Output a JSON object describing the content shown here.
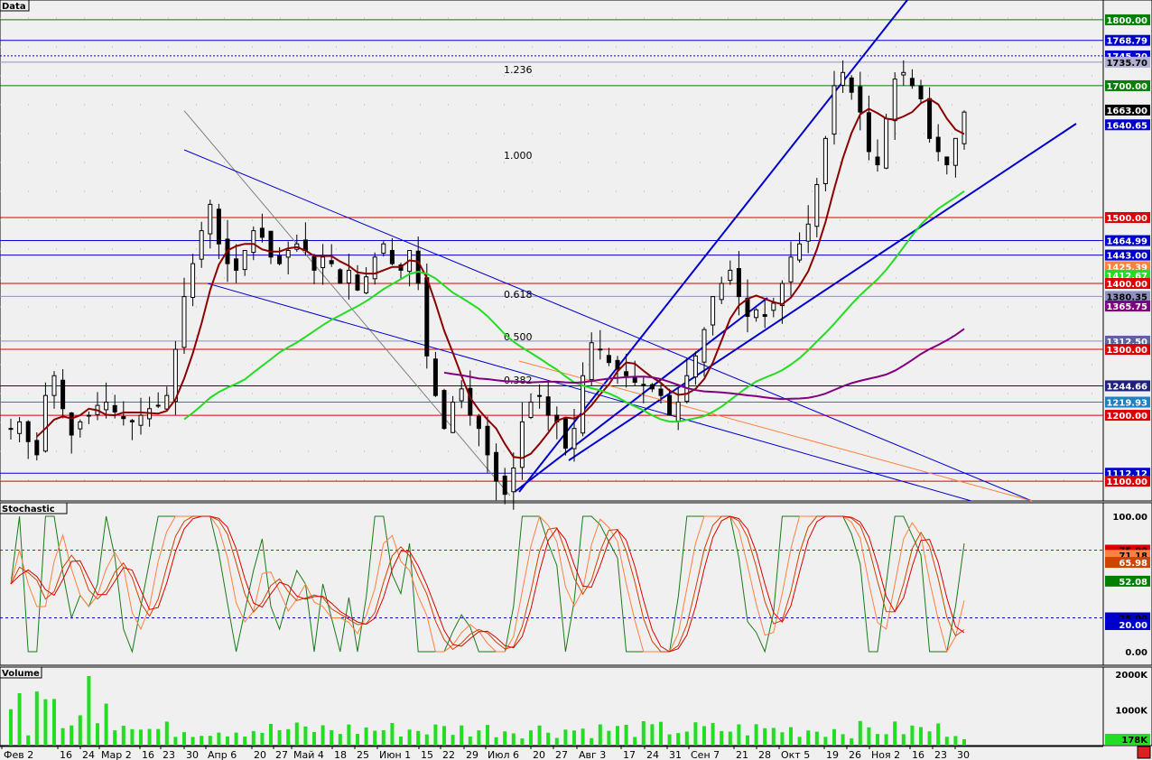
{
  "panels": {
    "price": "Data",
    "stochastic": "Stochastic",
    "volume": "Volume"
  },
  "x_axis": {
    "dates": [
      "Фев 2",
      "16",
      "24",
      "Мар 2",
      "16",
      "23",
      "30",
      "Апр 6",
      "20",
      "27",
      "Май 4",
      "18",
      "25",
      "Июн 1",
      "15",
      "22",
      "29",
      "Июл 6",
      "20",
      "27",
      "Авг 3",
      "17",
      "24",
      "31",
      "Сен 7",
      "21",
      "28",
      "Окт 5",
      "19",
      "26",
      "Ноя 2",
      "16",
      "23",
      "30"
    ]
  },
  "colors": {
    "background": "#f0f0f0",
    "trendline": "#0000cc",
    "ma_fast": "#8b0000",
    "ma_mid": "#22dd22",
    "ma_slow": "#800080",
    "fib_line": "#2020a0",
    "support_red": "#dd0000",
    "level_green": "#008000",
    "stoch_k": "#1a7a1a",
    "stoch_d": "#cc4400",
    "volume": "#22dd22"
  },
  "fib_labels": [
    "1.236",
    "1.000",
    "0.618",
    "0.500",
    "0.382"
  ],
  "price_tags": [
    {
      "text": "1800.00",
      "bg": "#008000",
      "fg": "#ffffff"
    },
    {
      "text": "1768.79",
      "bg": "#0000cc",
      "fg": "#ffffff"
    },
    {
      "text": "1745.20",
      "bg": "#0000cc",
      "fg": "#ffffff"
    },
    {
      "text": "1735.70",
      "bg": "#b0b0d0",
      "fg": "#000000"
    },
    {
      "text": "1700.00",
      "bg": "#008000",
      "fg": "#ffffff"
    },
    {
      "text": "1663.00",
      "bg": "#000000",
      "fg": "#ffffff"
    },
    {
      "text": "1640.65",
      "bg": "#0000cc",
      "fg": "#ffffff"
    },
    {
      "text": "1500.00",
      "bg": "#dd0000",
      "fg": "#ffffff"
    },
    {
      "text": "1464.99",
      "bg": "#0000cc",
      "fg": "#ffffff"
    },
    {
      "text": "1443.00",
      "bg": "#0000cc",
      "fg": "#ffffff"
    },
    {
      "text": "1425.39",
      "bg": "#ff8040",
      "fg": "#ffffff"
    },
    {
      "text": "1412.67",
      "bg": "#22dd22",
      "fg": "#ffffff"
    },
    {
      "text": "1400.00",
      "bg": "#dd0000",
      "fg": "#ffffff"
    },
    {
      "text": "1380.35",
      "bg": "#9090c0",
      "fg": "#000000"
    },
    {
      "text": "1365.75",
      "bg": "#800080",
      "fg": "#ffffff"
    },
    {
      "text": "1312.50",
      "bg": "#6060a0",
      "fg": "#ffffff"
    },
    {
      "text": "1300.00",
      "bg": "#dd0000",
      "fg": "#ffffff"
    },
    {
      "text": "1244.66",
      "bg": "#202080",
      "fg": "#ffffff"
    },
    {
      "text": "1219.93",
      "bg": "#2080c0",
      "fg": "#ffffff"
    },
    {
      "text": "1200.00",
      "bg": "#dd0000",
      "fg": "#ffffff"
    },
    {
      "text": "1112.12",
      "bg": "#0000cc",
      "fg": "#ffffff"
    },
    {
      "text": "1100.00",
      "bg": "#dd0000",
      "fg": "#ffffff"
    }
  ],
  "stoch_axis": [
    "100.00",
    "0.00"
  ],
  "stoch_tags": [
    {
      "text": "75.00",
      "bg": "#dd0000",
      "fg": "#000000"
    },
    {
      "text": "71.18",
      "bg": "#ff8040",
      "fg": "#000000"
    },
    {
      "text": "65.98",
      "bg": "#cc4400",
      "fg": "#ffffff"
    },
    {
      "text": "52.08",
      "bg": "#008000",
      "fg": "#ffffff"
    },
    {
      "text": "25.00",
      "bg": "#0000cc",
      "fg": "#000000"
    },
    {
      "text": "20.00",
      "bg": "#0000cc",
      "fg": "#ffffff"
    }
  ],
  "volume_axis": [
    "2000K",
    "1000K"
  ],
  "volume_tag": {
    "text": "178K",
    "bg": "#22dd22",
    "fg": "#000000"
  },
  "chart_data": {
    "type": "candlestick",
    "title": "",
    "ylim": [
      1070,
      1830
    ],
    "horizontal_levels": [
      1800,
      1768.79,
      1745.2,
      1735.7,
      1700,
      1663,
      1640.65,
      1500,
      1464.99,
      1443,
      1425.39,
      1412.67,
      1400,
      1380.35,
      1365.75,
      1312.5,
      1300,
      1244.66,
      1219.93,
      1200,
      1112.12,
      1100
    ],
    "close_approx": [
      1180,
      1190,
      1160,
      1140,
      1230,
      1260,
      1210,
      1170,
      1190,
      1200,
      1215,
      1220,
      1205,
      1195,
      1190,
      1200,
      1210,
      1215,
      1230,
      1300,
      1380,
      1430,
      1480,
      1520,
      1460,
      1430,
      1420,
      1450,
      1480,
      1470,
      1440,
      1430,
      1450,
      1460,
      1450,
      1420,
      1440,
      1430,
      1400,
      1420,
      1390,
      1410,
      1440,
      1460,
      1430,
      1420,
      1450,
      1400,
      1290,
      1230,
      1180,
      1220,
      1240,
      1200,
      1180,
      1140,
      1100,
      1080,
      1120,
      1190,
      1220,
      1230,
      1200,
      1190,
      1150,
      1180,
      1260,
      1310,
      1300,
      1280,
      1270,
      1260,
      1250,
      1245,
      1240,
      1230,
      1200,
      1220,
      1260,
      1290,
      1330,
      1380,
      1400,
      1420,
      1380,
      1350,
      1360,
      1350,
      1370,
      1400,
      1440,
      1460,
      1490,
      1550,
      1620,
      1700,
      1720,
      1690,
      1660,
      1600,
      1580,
      1650,
      1710,
      1720,
      1700,
      1680,
      1620,
      1600,
      1580,
      1620,
      1660
    ],
    "ma_fast_last": 1663.0,
    "ma_mid_last": 1412.67,
    "ma_slow_last": 1365.75,
    "fib_levels": [
      1.236,
      1.0,
      0.618,
      0.5,
      0.382
    ],
    "stochastic": {
      "overbought": 75,
      "oversold": 25,
      "k_last": 52.08,
      "d_last": 65.98,
      "slow_last": 71.18,
      "ylim": [
        0,
        100
      ]
    },
    "volume": {
      "ylim": [
        0,
        2000000
      ],
      "last": 178000
    }
  }
}
